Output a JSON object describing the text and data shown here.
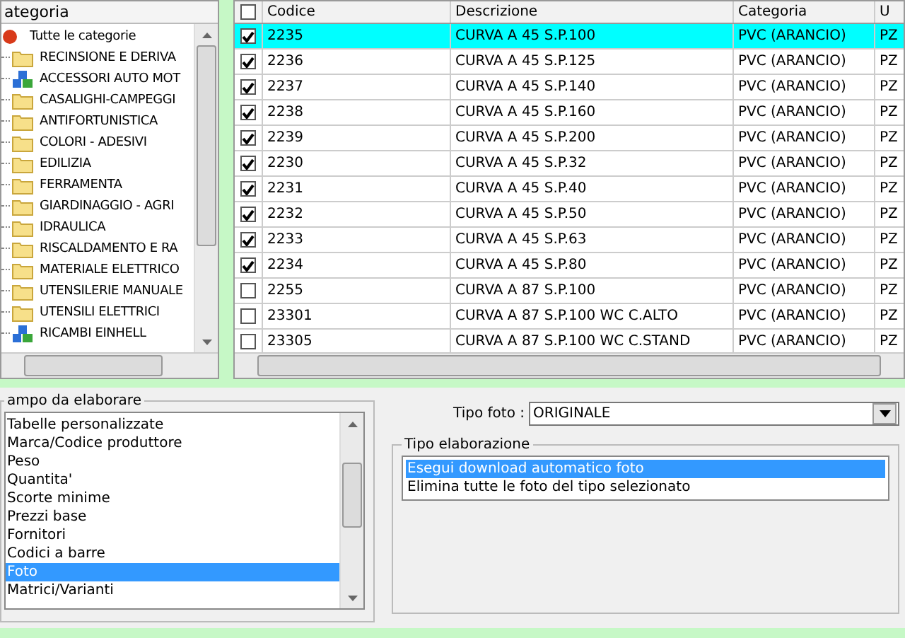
{
  "category_tree": {
    "header": "ategoria",
    "root": {
      "label": "Tutte le categorie",
      "children": [
        {
          "label": "RECINSIONE E DERIVA",
          "kind": "folder"
        },
        {
          "label": "ACCESSORI AUTO MOT",
          "kind": "blocks"
        },
        {
          "label": "CASALIGHI-CAMPEGGI",
          "kind": "folder"
        },
        {
          "label": "ANTIFORTUNISTICA",
          "kind": "folder"
        },
        {
          "label": "COLORI - ADESIVI",
          "kind": "folder"
        },
        {
          "label": "EDILIZIA",
          "kind": "folder"
        },
        {
          "label": "FERRAMENTA",
          "kind": "folder"
        },
        {
          "label": "GIARDINAGGIO - AGRI",
          "kind": "folder"
        },
        {
          "label": "IDRAULICA",
          "kind": "folder"
        },
        {
          "label": "RISCALDAMENTO E RA",
          "kind": "folder"
        },
        {
          "label": "MATERIALE ELETTRICO",
          "kind": "folder"
        },
        {
          "label": "UTENSILERIE MANUALE",
          "kind": "folder"
        },
        {
          "label": "UTENSILI ELETTRICI",
          "kind": "folder"
        },
        {
          "label": "RICAMBI EINHELL",
          "kind": "blocks"
        }
      ]
    }
  },
  "table": {
    "select_all": {
      "checked": false
    },
    "columns": [
      "Codice",
      "Descrizione",
      "Categoria",
      "U"
    ],
    "rows": [
      {
        "checked": true,
        "selected": true,
        "cells": [
          "2235",
          "CURVA A 45 S.P.100",
          "PVC (ARANCIO)",
          "PZ"
        ]
      },
      {
        "checked": true,
        "selected": false,
        "cells": [
          "2236",
          "CURVA A 45 S.P.125",
          "PVC (ARANCIO)",
          "PZ"
        ]
      },
      {
        "checked": true,
        "selected": false,
        "cells": [
          "2237",
          "CURVA A 45 S.P.140",
          "PVC (ARANCIO)",
          "PZ"
        ]
      },
      {
        "checked": true,
        "selected": false,
        "cells": [
          "2238",
          "CURVA A 45 S.P.160",
          "PVC (ARANCIO)",
          "PZ"
        ]
      },
      {
        "checked": true,
        "selected": false,
        "cells": [
          "2239",
          "CURVA A 45 S.P.200",
          "PVC (ARANCIO)",
          "PZ"
        ]
      },
      {
        "checked": true,
        "selected": false,
        "cells": [
          "2230",
          "CURVA A 45 S.P.32",
          "PVC (ARANCIO)",
          "PZ"
        ]
      },
      {
        "checked": true,
        "selected": false,
        "cells": [
          "2231",
          "CURVA A 45 S.P.40",
          "PVC (ARANCIO)",
          "PZ"
        ]
      },
      {
        "checked": true,
        "selected": false,
        "cells": [
          "2232",
          "CURVA A 45 S.P.50",
          "PVC (ARANCIO)",
          "PZ"
        ]
      },
      {
        "checked": true,
        "selected": false,
        "cells": [
          "2233",
          "CURVA A 45 S.P.63",
          "PVC (ARANCIO)",
          "PZ"
        ]
      },
      {
        "checked": true,
        "selected": false,
        "cells": [
          "2234",
          "CURVA A 45 S.P.80",
          "PVC (ARANCIO)",
          "PZ"
        ]
      },
      {
        "checked": false,
        "selected": false,
        "cells": [
          "2255",
          "CURVA A 87 S.P.100",
          "PVC (ARANCIO)",
          "PZ"
        ]
      },
      {
        "checked": false,
        "selected": false,
        "cells": [
          "23301",
          "CURVA A 87 S.P.100 WC C.ALTO",
          "PVC (ARANCIO)",
          "PZ"
        ]
      },
      {
        "checked": false,
        "selected": false,
        "cells": [
          "23305",
          "CURVA A 87 S.P.100 WC C.STAND",
          "PVC (ARANCIO)",
          "PZ"
        ]
      }
    ]
  },
  "field_group": {
    "title": "ampo da elaborare",
    "items": [
      {
        "label": "Tabelle personalizzate",
        "selected": false
      },
      {
        "label": "Marca/Codice produttore",
        "selected": false
      },
      {
        "label": "Peso",
        "selected": false
      },
      {
        "label": "Quantita'",
        "selected": false
      },
      {
        "label": "Scorte minime",
        "selected": false
      },
      {
        "label": "Prezzi base",
        "selected": false
      },
      {
        "label": "Fornitori",
        "selected": false
      },
      {
        "label": "Codici a barre",
        "selected": false
      },
      {
        "label": "Foto",
        "selected": true
      },
      {
        "label": "Matrici/Varianti",
        "selected": false
      }
    ]
  },
  "photo_type": {
    "label": "Tipo foto :",
    "value": "ORIGINALE"
  },
  "processing_group": {
    "title": "Tipo elaborazione",
    "items": [
      {
        "label": "Esegui download automatico foto",
        "selected": true
      },
      {
        "label": "Elimina tutte le foto del tipo selezionato",
        "selected": false
      }
    ]
  }
}
